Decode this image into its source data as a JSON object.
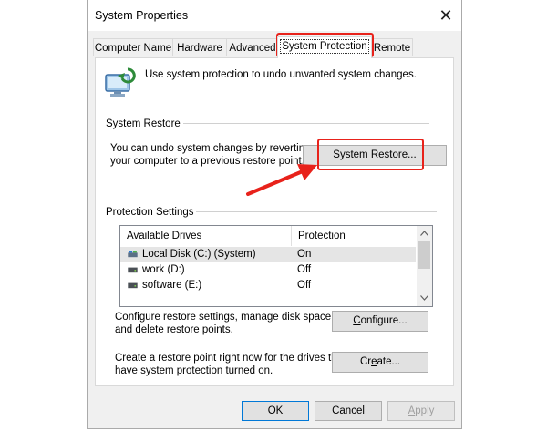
{
  "window": {
    "title": "System Properties",
    "close_glyph": "✕"
  },
  "tabs": [
    {
      "label": "Computer Name"
    },
    {
      "label": "Hardware"
    },
    {
      "label": "Advanced"
    },
    {
      "label": "System Protection",
      "active": true
    },
    {
      "label": "Remote"
    }
  ],
  "intro": {
    "text": "Use system protection to undo unwanted system changes.",
    "icon": "system-protection-icon"
  },
  "system_restore": {
    "header": "System Restore",
    "line1": "You can undo system changes by reverting",
    "line2": "your computer to a previous restore point.",
    "button_prefix": "",
    "button_underlined": "S",
    "button_suffix": "ystem Restore..."
  },
  "protection": {
    "header": "Protection Settings",
    "columns": [
      "Available Drives",
      "Protection"
    ],
    "drives": [
      {
        "name": "Local Disk (C:) (System)",
        "status": "On",
        "icon": "system-drive-icon",
        "selected": true
      },
      {
        "name": "work (D:)",
        "status": "Off",
        "icon": "drive-icon"
      },
      {
        "name": "software (E:)",
        "status": "Off",
        "icon": "drive-icon"
      }
    ],
    "configure_line1": "Configure restore settings, manage disk space,",
    "configure_line2": "and delete restore points.",
    "configure_pre": "",
    "configure_u": "C",
    "configure_post": "onfigure...",
    "create_line1": "Create a restore point right now for the drives that",
    "create_line2": "have system protection turned on.",
    "create_pre": "Cr",
    "create_u": "e",
    "create_post": "ate..."
  },
  "footer": {
    "ok": "OK",
    "cancel": "Cancel",
    "apply_pre": "",
    "apply_u": "A",
    "apply_post": "pply"
  },
  "colors": {
    "highlight": "#e8221b",
    "window_bg": "#f0f0f0",
    "button_bg": "#e1e1e1"
  }
}
